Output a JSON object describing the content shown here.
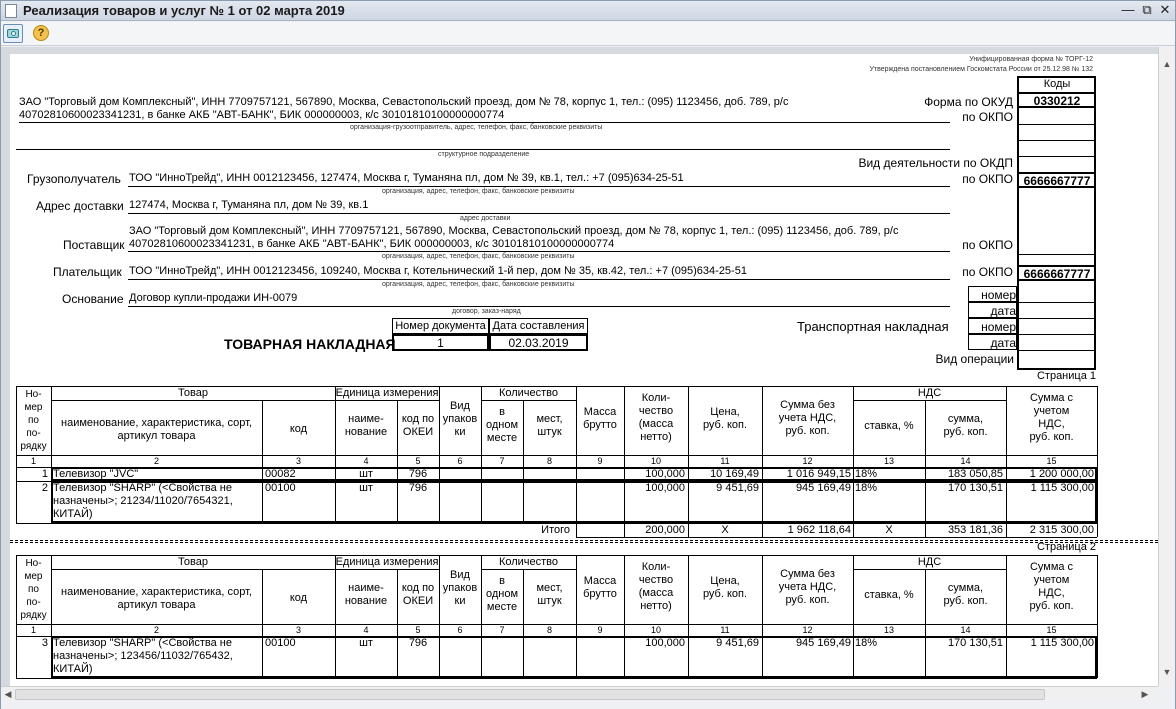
{
  "window": {
    "title": "Реализация товаров и услуг № 1 от 02 марта 2019",
    "min": "—",
    "restore": "⧉",
    "close": "✕"
  },
  "toolbar": {
    "help": "?"
  },
  "doc": {
    "form_title": "Унифицированная форма № ТОРГ-12",
    "form_approved": "Утверждена постановлением Госкомстата России от 25.12.98 № 132",
    "codes_label": "Коды",
    "okud_label": "Форма по ОКУД",
    "okud_value": "0330212",
    "okpo_label": "по ОКПО",
    "okdp_label": "Вид деятельности по ОКДП",
    "shipper_line1": "ЗАО \"Торговый дом Комплексный\", ИНН 7709757121, 567890, Москва, Севастопольский проезд, дом № 78, корпус 1, тел.: (095) 1123456, доб. 789, р/с",
    "shipper_line2": "40702810600023341231, в банке АКБ \"АВТ-БАНК\", БИК 000000003, к/с 30101810100000000774",
    "shipper_caption": "организация-грузоотправитель, адрес, телефон, факс, банковские реквизиты",
    "subdivision_caption": "структурное подразделение",
    "consignee_label": "Грузополучатель",
    "consignee_value": "ТОО \"ИнноТрейд\", ИНН 0012123456, 127474, Москва г, Туманяна пл, дом № 39, кв.1, тел.: +7 (095)634-25-51",
    "consignee_okpo": "6666667777",
    "org_caption": "организация, адрес, телефон, факс, банковские реквизиты",
    "delivery_label": "Адрес доставки",
    "delivery_value": "127474, Москва г, Туманяна пл, дом № 39, кв.1",
    "delivery_caption": "адрес доставки",
    "supplier_label": "Поставщик",
    "supplier_line1": "ЗАО \"Торговый дом Комплексный\", ИНН 7709757121, 567890, Москва, Севастопольский проезд, дом № 78, корпус 1, тел.: (095) 1123456, доб. 789, р/с",
    "supplier_line2": "40702810600023341231, в банке АКБ \"АВТ-БАНК\", БИК 000000003, к/с 30101810100000000774",
    "payer_label": "Плательщик",
    "payer_value": "ТОО \"ИнноТрейд\", ИНН 0012123456, 109240, Москва г, Котельнический 1-й пер, дом № 35, кв.42, тел.: +7 (095)634-25-51",
    "payer_okpo": "6666667777",
    "basis_label": "Основание",
    "basis_value": "Договор купли-продажи ИН-0079",
    "basis_caption": "договор, заказ-наряд",
    "number_label": "номер",
    "date_label": "дата",
    "transport_label": "Транспортная накладная",
    "operation_label": "Вид операции",
    "docnum_header": "Номер документа",
    "docdate_header": "Дата составления",
    "docnum_value": "1",
    "docdate_value": "02.03.2019",
    "invoice_title": "ТОВАРНАЯ НАКЛАДНАЯ",
    "page1": "Страница 1",
    "page2": "Страница 2"
  },
  "table": {
    "h_num": "Но-\nмер\nпо\nпо-\nрядку",
    "h_goods": "Товар",
    "h_goods_name": "наименование, характеристика, сорт, артикул товара",
    "h_code": "код",
    "h_unit": "Единица измерения",
    "h_unit_name": "наиме-\nнование",
    "h_unit_okei": "код по\nОКЕИ",
    "h_pack": "Вид\nупаков\nки",
    "h_qty": "Количество",
    "h_qty_one": "в\nодном\nместе",
    "h_qty_places": "мест,\nштук",
    "h_mass": "Масса\nбрутто",
    "h_net": "Коли-\nчество\n(масса\nнетто)",
    "h_price": "Цена,\nруб. коп.",
    "h_sum_novat": "Сумма без\nучета НДС,\nруб. коп.",
    "h_vat": "НДС",
    "h_vat_rate": "ставка, %",
    "h_vat_sum": "сумма,\nруб. коп.",
    "h_sum_vat": "Сумма с\nучетом\nНДС,\nруб. коп.",
    "col_nums": [
      "1",
      "2",
      "3",
      "4",
      "5",
      "6",
      "7",
      "8",
      "9",
      "10",
      "11",
      "12",
      "13",
      "14",
      "15"
    ],
    "rows1": [
      {
        "n": "1",
        "name": "Телевизор \"JVC\"",
        "code": "00082",
        "unit": "шт",
        "okei": "796",
        "net": "100,000",
        "price": "10 169,49",
        "sum": "1 016 949,15",
        "rate": "18%",
        "vat": "183 050,85",
        "total": "1 200 000,00"
      },
      {
        "n": "2",
        "name": "Телевизор \"SHARP\" (<Свойства не назначены>; 21234/11020/7654321, КИТАЙ)",
        "code": "00100",
        "unit": "шт",
        "okei": "796",
        "net": "100,000",
        "price": "9 451,69",
        "sum": "945 169,49",
        "rate": "18%",
        "vat": "170 130,51",
        "total": "1 115 300,00"
      }
    ],
    "total_label": "Итого",
    "total_net": "200,000",
    "total_price": "X",
    "total_sum": "1 962 118,64",
    "total_rate": "X",
    "total_vat": "353 181,36",
    "total_total": "2 315 300,00",
    "rows2": [
      {
        "n": "3",
        "name": "Телевизор \"SHARP\" (<Свойства не назначены>; 123456/11032/765432, КИТАЙ)",
        "code": "00100",
        "unit": "шт",
        "okei": "796",
        "net": "100,000",
        "price": "9 451,69",
        "sum": "945 169,49",
        "rate": "18%",
        "vat": "170 130,51",
        "total": "1 115 300,00"
      }
    ]
  }
}
